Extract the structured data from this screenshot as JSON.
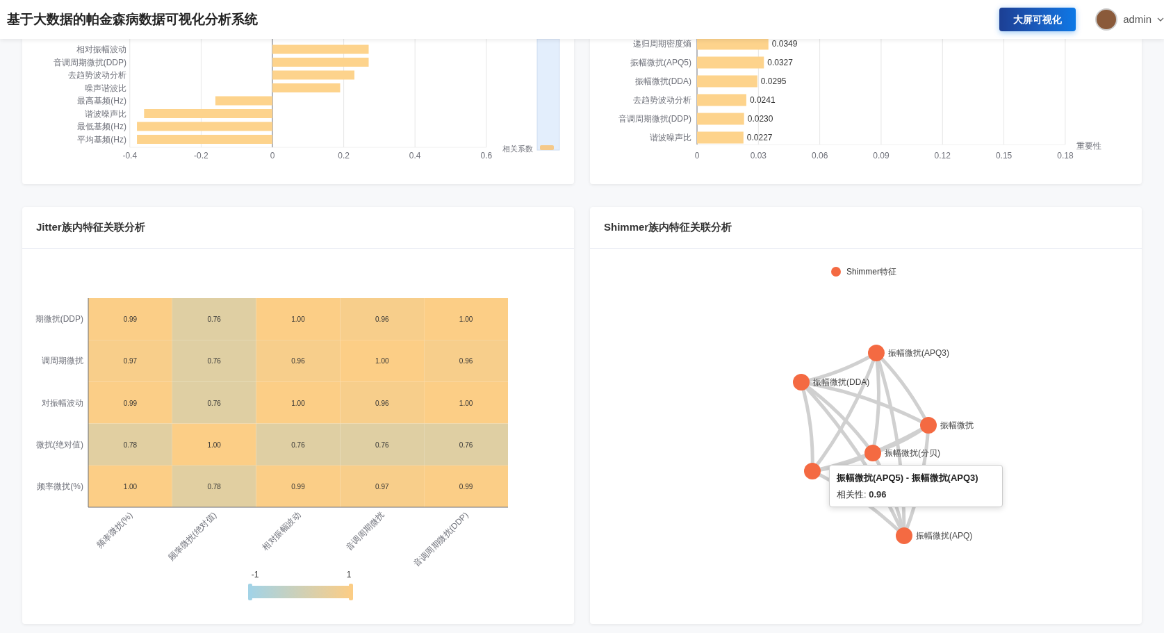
{
  "header": {
    "title": "基于大数据的帕金森病数据可视化分析系统",
    "button": "大屏可视化",
    "user": "admin"
  },
  "correlation_panel": {
    "visual_map_label": "相关系数",
    "chart_data": {
      "type": "bar",
      "orientation": "horizontal",
      "categories": [
        "相对振幅波动",
        "音调周期微扰(DDP)",
        "去趋势波动分析",
        "噪声谐波比",
        "最高基频(Hz)",
        "谐波噪声比",
        "最低基频(Hz)",
        "平均基频(Hz)"
      ],
      "values": [
        0.27,
        0.27,
        0.23,
        0.19,
        -0.16,
        -0.36,
        -0.38,
        -0.38
      ],
      "xticks": [
        -0.4,
        -0.2,
        0,
        0.2,
        0.4,
        0.6
      ],
      "xlim": [
        -0.4,
        0.6
      ],
      "grid": true
    }
  },
  "importance_panel": {
    "chart_data": {
      "type": "bar",
      "orientation": "horizontal",
      "xlabel": "重要性",
      "categories": [
        "递归周期密度熵",
        "振幅微扰(APQ5)",
        "振幅微扰(DDA)",
        "去趋势波动分析",
        "音调周期微扰(DDP)",
        "谐波噪声比"
      ],
      "values": [
        0.0349,
        0.0327,
        0.0295,
        0.0241,
        0.023,
        0.0227
      ],
      "value_labels": [
        "0.0349",
        "0.0327",
        "0.0295",
        "0.0241",
        "0.0230",
        "0.0227"
      ],
      "xticks": [
        0,
        0.03,
        0.06,
        0.09,
        0.12,
        0.15,
        0.18
      ],
      "xlim": [
        0,
        0.18
      ],
      "grid": true
    }
  },
  "jitter_panel": {
    "title": "Jitter族内特征关联分析",
    "x_axis_labels": [
      "频率微扰(%)",
      "频率微扰(绝对值)",
      "相对振幅波动",
      "音调周期微扰",
      "音调周期微扰(DDP)"
    ],
    "rows": [
      {
        "label": "期微扰(DDP)",
        "cells": [
          "0.99",
          "0.76",
          "1.00",
          "0.96",
          "1.00"
        ]
      },
      {
        "label": "调周期微扰",
        "cells": [
          "0.97",
          "0.76",
          "0.96",
          "1.00",
          "0.96"
        ]
      },
      {
        "label": "对振幅波动",
        "cells": [
          "0.99",
          "0.76",
          "1.00",
          "0.96",
          "1.00"
        ]
      },
      {
        "label": "微扰(绝对值)",
        "cells": [
          "0.78",
          "1.00",
          "0.76",
          "0.76",
          "0.76"
        ]
      },
      {
        "label": "频率微扰(%)",
        "cells": [
          "1.00",
          "0.78",
          "0.99",
          "0.97",
          "0.99"
        ]
      }
    ],
    "scale": {
      "min_label": "-1",
      "max_label": "1"
    }
  },
  "shimmer_panel": {
    "title": "Shimmer族内特征关联分析",
    "legend": {
      "label": "Shimmer特征",
      "color": "#f46a42"
    },
    "nodes": [
      {
        "kind": "labeled",
        "label": "振幅微扰(APQ3)"
      },
      {
        "kind": "labeled",
        "label": "振幅微扰(DDA)"
      },
      {
        "kind": "labeled",
        "label": "振幅微扰"
      },
      {
        "kind": "labeled",
        "label": "振幅微扰(分贝)"
      },
      {
        "kind": "covered"
      },
      {
        "kind": "labeled",
        "label": "振幅微扰(APQ)"
      }
    ],
    "tooltip": {
      "title": "振幅微扰(APQ5) - 振幅微扰(APQ3)",
      "text": "相关性: **0.96**"
    }
  }
}
